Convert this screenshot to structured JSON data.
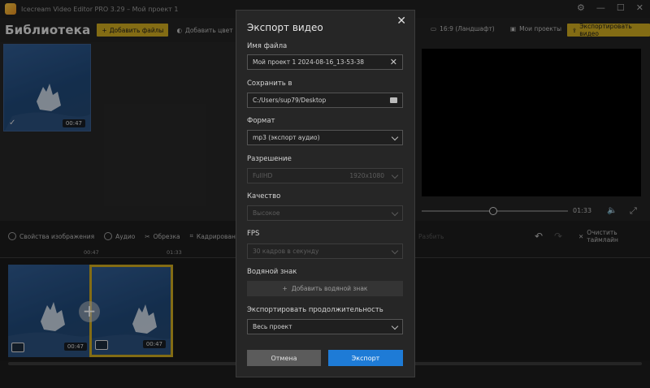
{
  "app": {
    "title": "Icecream Video Editor PRO 3.29  –  Мой проект 1"
  },
  "toolbar": {
    "library_title": "Библиотека",
    "add_files": "Добавить файлы",
    "add_color": "Добавить цвет",
    "aspect": "16:9 (Ландшафт)",
    "my_projects": "Мои проекты",
    "export_video": "Экспортировать видео"
  },
  "library": {
    "item_duration": "00:47"
  },
  "preview": {
    "time": "01:33",
    "progress": 0.49
  },
  "edit_toolbar": {
    "image_props": "Свойства изображения",
    "audio": "Аудио",
    "trim": "Обрезка",
    "crop": "Кадрирование",
    "split": "Разбить",
    "clear_timeline": "Очистить таймлайн"
  },
  "timeline": {
    "marks": [
      "00:47",
      "01:33"
    ],
    "clips": [
      {
        "duration": "00:47"
      },
      {
        "duration": "00:47"
      }
    ]
  },
  "dialog": {
    "title": "Экспорт видео",
    "filename_label": "Имя файла",
    "filename_value": "Мой проект 1 2024-08-16_13-53-38",
    "save_to_label": "Сохранить в",
    "save_to_value": "C:/Users/sup79/Desktop",
    "format_label": "Формат",
    "format_value": "mp3 (экспорт аудио)",
    "resolution_label": "Разрешение",
    "resolution_value": "FullHD",
    "resolution_size": "1920x1080",
    "quality_label": "Качество",
    "quality_value": "Высокое",
    "fps_label": "FPS",
    "fps_value": "30 кадров в секунду",
    "watermark_label": "Водяной знак",
    "watermark_button": "Добавить водяной знак",
    "duration_label": "Экспортировать продолжительность",
    "duration_value": "Весь проект",
    "cancel": "Отмена",
    "export": "Экспорт"
  },
  "colors": {
    "accent_yellow": "#c9a620",
    "export_blue": "#1e7bd6"
  }
}
